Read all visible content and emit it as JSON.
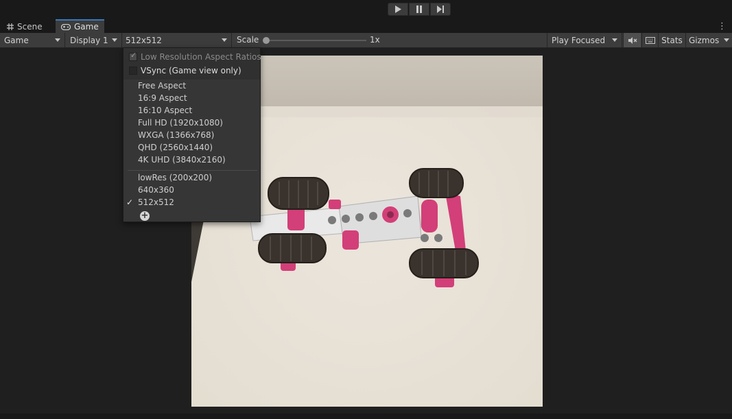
{
  "playbar": {
    "play": "play-icon",
    "pause": "pause-icon",
    "step": "step-icon"
  },
  "tabs": [
    {
      "label": "Scene",
      "icon": "grid-icon"
    },
    {
      "label": "Game",
      "icon": "gamepad-icon"
    }
  ],
  "toolbar": {
    "view_type": "Game",
    "display": "Display 1",
    "resolution": "512x512",
    "scale_label": "Scale",
    "scale_value": "1x",
    "play_mode": "Play Focused",
    "stats": "Stats",
    "gizmos": "Gizmos"
  },
  "menu": {
    "options": [
      {
        "label": "Low Resolution Aspect Ratios",
        "checked": true,
        "disabled": true
      },
      {
        "label": "VSync (Game view only)",
        "checked": false,
        "disabled": false
      }
    ],
    "aspects": [
      "Free Aspect",
      "16:9 Aspect",
      "16:10 Aspect",
      "Full HD (1920x1080)",
      "WXGA (1366x768)",
      "QHD (2560x1440)",
      "4K UHD (3840x2160)"
    ],
    "custom": [
      "lowRes (200x200)",
      "640x360",
      "512x512"
    ],
    "selected": "512x512",
    "check_glyph": "✓",
    "add_glyph": "+"
  },
  "colors": {
    "accent": "#3a79bb",
    "pink": "#d33f78",
    "tire": "#3a332d",
    "floor": "#e6e0d6"
  }
}
